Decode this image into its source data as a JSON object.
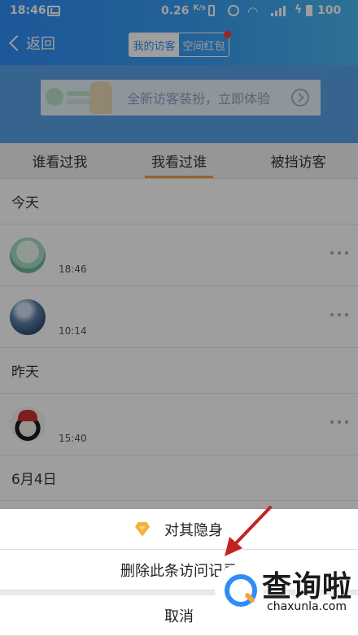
{
  "status_bar": {
    "time": "18:46",
    "speed": "0.26",
    "speed_unit": "K/s",
    "battery": "100",
    "icons": [
      "message-icon",
      "vibrate-icon",
      "alarm-icon",
      "wifi-icon",
      "signal-icon",
      "charging-icon",
      "battery-icon"
    ]
  },
  "nav": {
    "back_label": "返回",
    "segment_tabs": [
      {
        "label": "我的访客",
        "active": true
      },
      {
        "label": "空间红包",
        "active": false,
        "badge": true
      }
    ]
  },
  "banner": {
    "text": "全新访客装扮，立即体验",
    "arrow_icon": "arrow-right-circle-icon"
  },
  "tabs": [
    {
      "label": "谁看过我",
      "active": false
    },
    {
      "label": "我看过谁",
      "active": true
    },
    {
      "label": "被挡访客",
      "active": false
    }
  ],
  "list": {
    "sections": [
      {
        "title": "今天",
        "rows": [
          {
            "time": "18:46"
          },
          {
            "time": "10:14"
          }
        ]
      },
      {
        "title": "昨天",
        "rows": [
          {
            "time": "15:40"
          }
        ]
      },
      {
        "title": "6月4日",
        "rows": []
      }
    ]
  },
  "action_sheet": {
    "hide_label": "对其隐身",
    "delete_label": "删除此条访问记录",
    "cancel_label": "取消"
  },
  "watermark": {
    "title": "查询啦",
    "subtitle": "chaxunla.com"
  },
  "colors": {
    "header_blue": "#2f8ef5",
    "tab_indicator": "#f0a33c",
    "badge_red": "#ff3b30",
    "diamond_gold": "#f3b23a"
  }
}
